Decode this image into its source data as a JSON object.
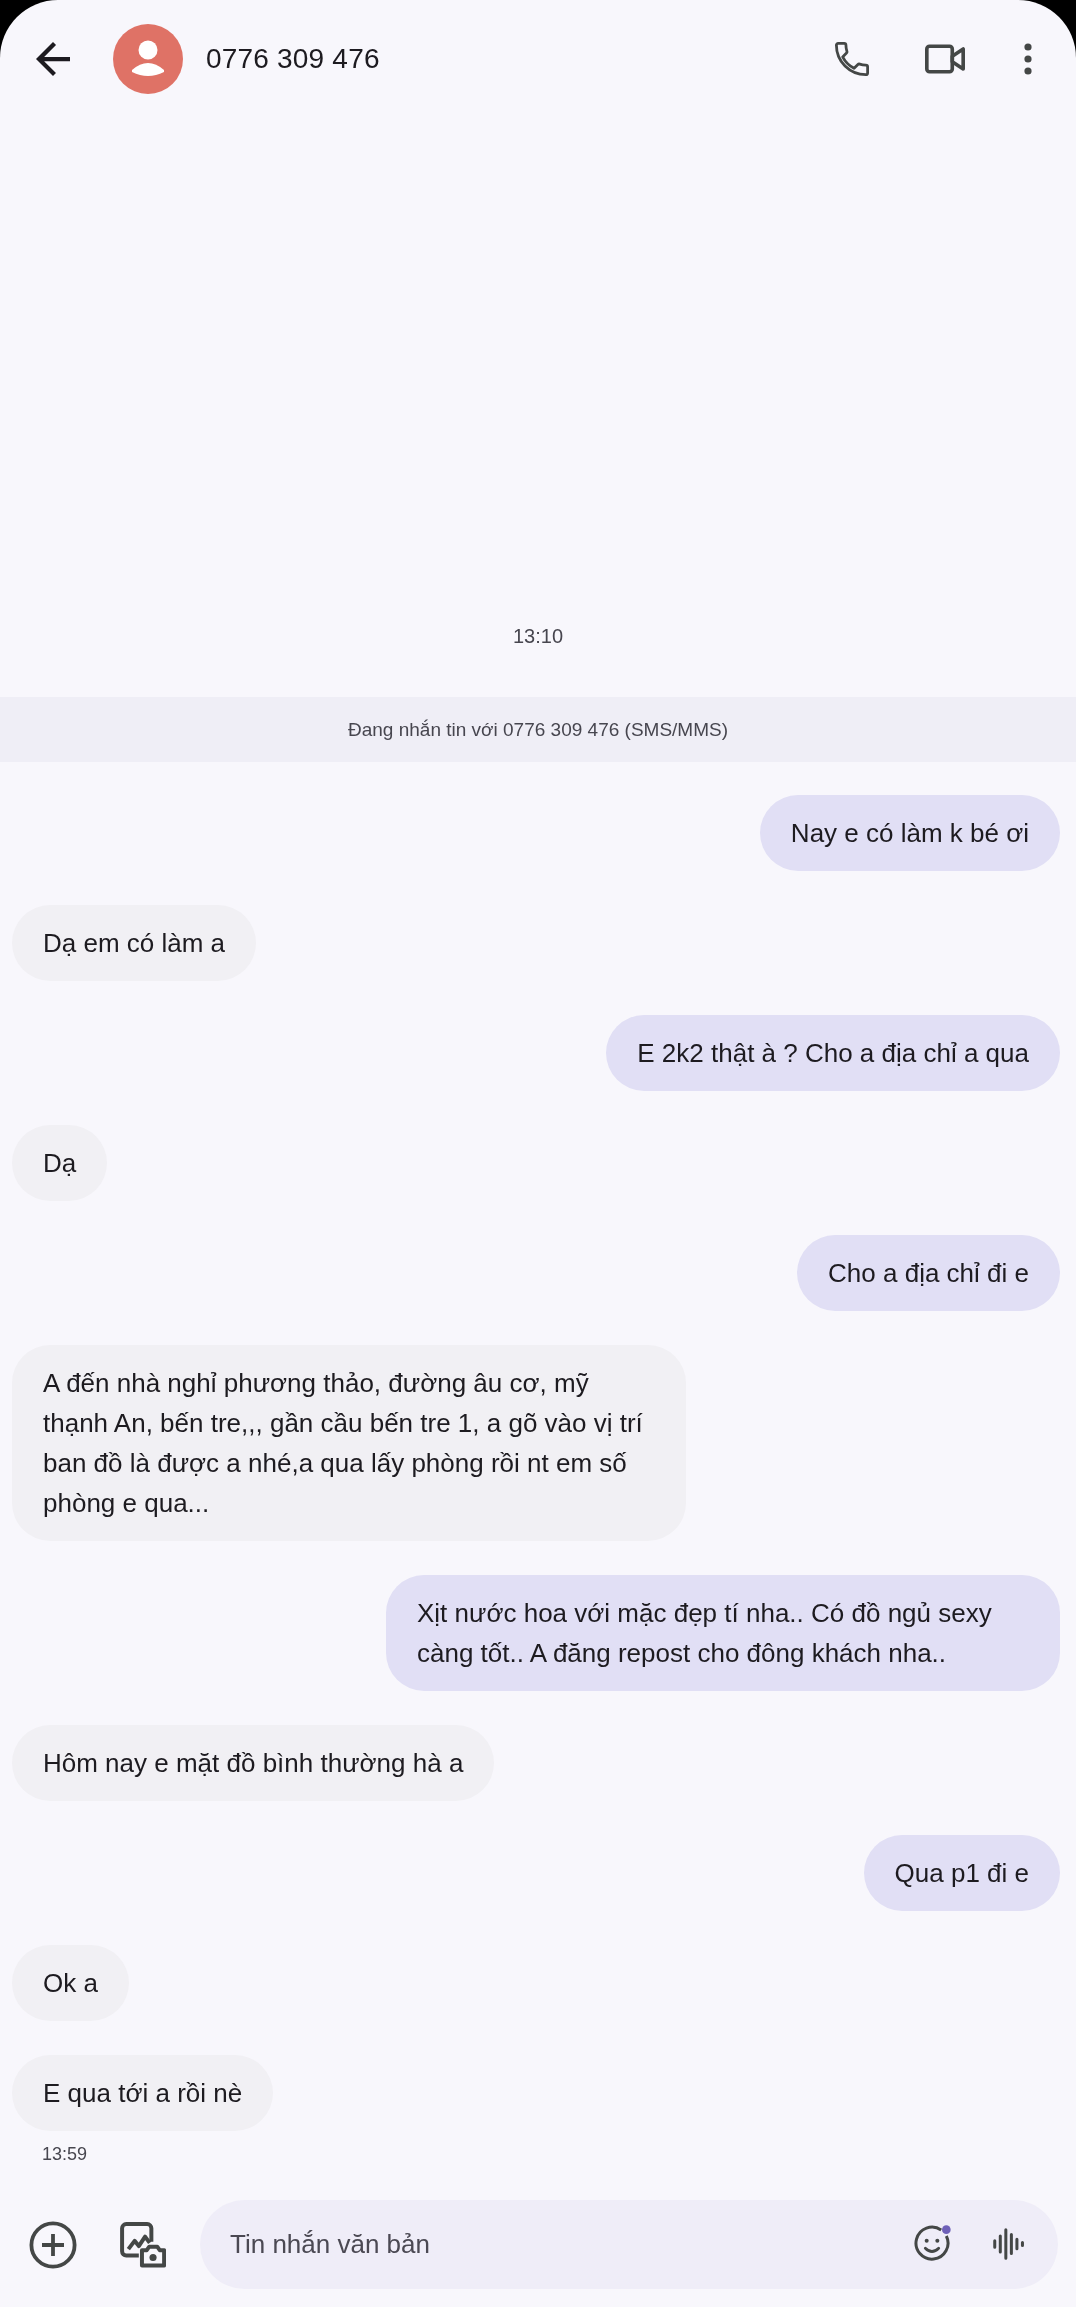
{
  "header": {
    "title": "0776 309 476"
  },
  "conversation": {
    "date_time": "13:10",
    "notice": "Đang nhắn tin với 0776 309 476 (SMS/MMS)",
    "messages": [
      {
        "kind": "sent",
        "text": "Nay e có làm k bé ơi"
      },
      {
        "kind": "received",
        "text": "Dạ em có làm a"
      },
      {
        "kind": "sent",
        "text": "E 2k2 thật à ? Cho a địa chỉ a qua"
      },
      {
        "kind": "received",
        "text": "Dạ"
      },
      {
        "kind": "sent",
        "text": "Cho a địa chỉ đi e"
      },
      {
        "kind": "received",
        "text": "A đến nhà nghỉ phương thảo, đường âu cơ, mỹ thạnh An, bến tre,,, gần cầu bến tre 1, a gõ vào vị trí ban đồ là được a nhé,a qua lấy phòng rồi nt em số phòng e qua..."
      },
      {
        "kind": "sent",
        "text": "Xịt nước hoa với mặc đẹp tí nha.. Có đồ ngủ sexy càng tốt.. A đăng repost cho đông khách nha.."
      },
      {
        "kind": "received",
        "text": "Hôm nay e mặt đồ bình thường hà a"
      },
      {
        "kind": "sent",
        "text": "Qua p1 đi e"
      },
      {
        "kind": "received",
        "text": "Ok a"
      },
      {
        "kind": "received",
        "text": "E qua tới a rồi nè"
      }
    ],
    "last_message_time": "13:59"
  },
  "composer": {
    "placeholder": "Tin nhắn văn bản"
  }
}
